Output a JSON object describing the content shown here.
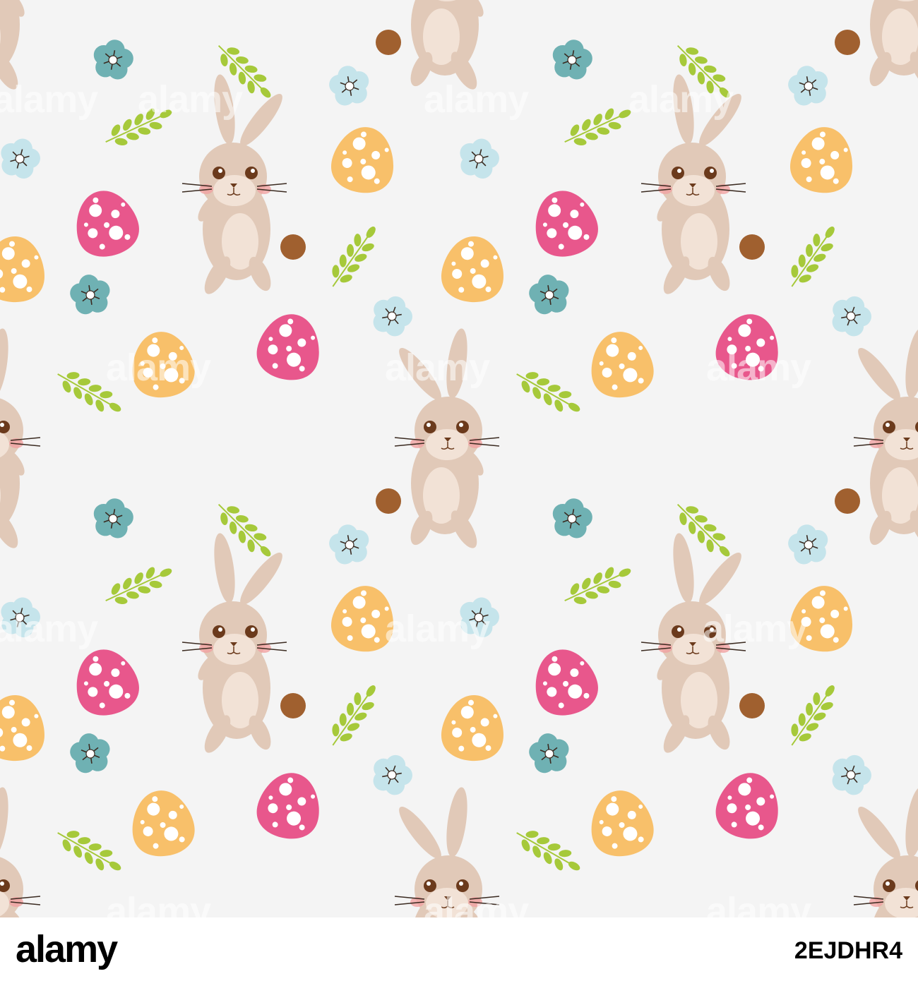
{
  "watermark": {
    "text": "alamy"
  },
  "footer": {
    "brand": "alamy",
    "image_id": "2EJDHR4"
  },
  "palette": {
    "background": "#f4f4f4",
    "bunny_body": "#e1c9b8",
    "bunny_belly": "#f2e2d6",
    "bunny_tail": "#a0602f",
    "egg_pink": "#e8578c",
    "egg_orange": "#f8c06a",
    "leaf_green": "#a6c93a",
    "flower_teal": "#6fb1b3",
    "flower_light": "#c5e4eb"
  },
  "icons": [
    "bunny-icon",
    "easter-egg-icon",
    "flower-icon",
    "leaf-sprig-icon"
  ]
}
